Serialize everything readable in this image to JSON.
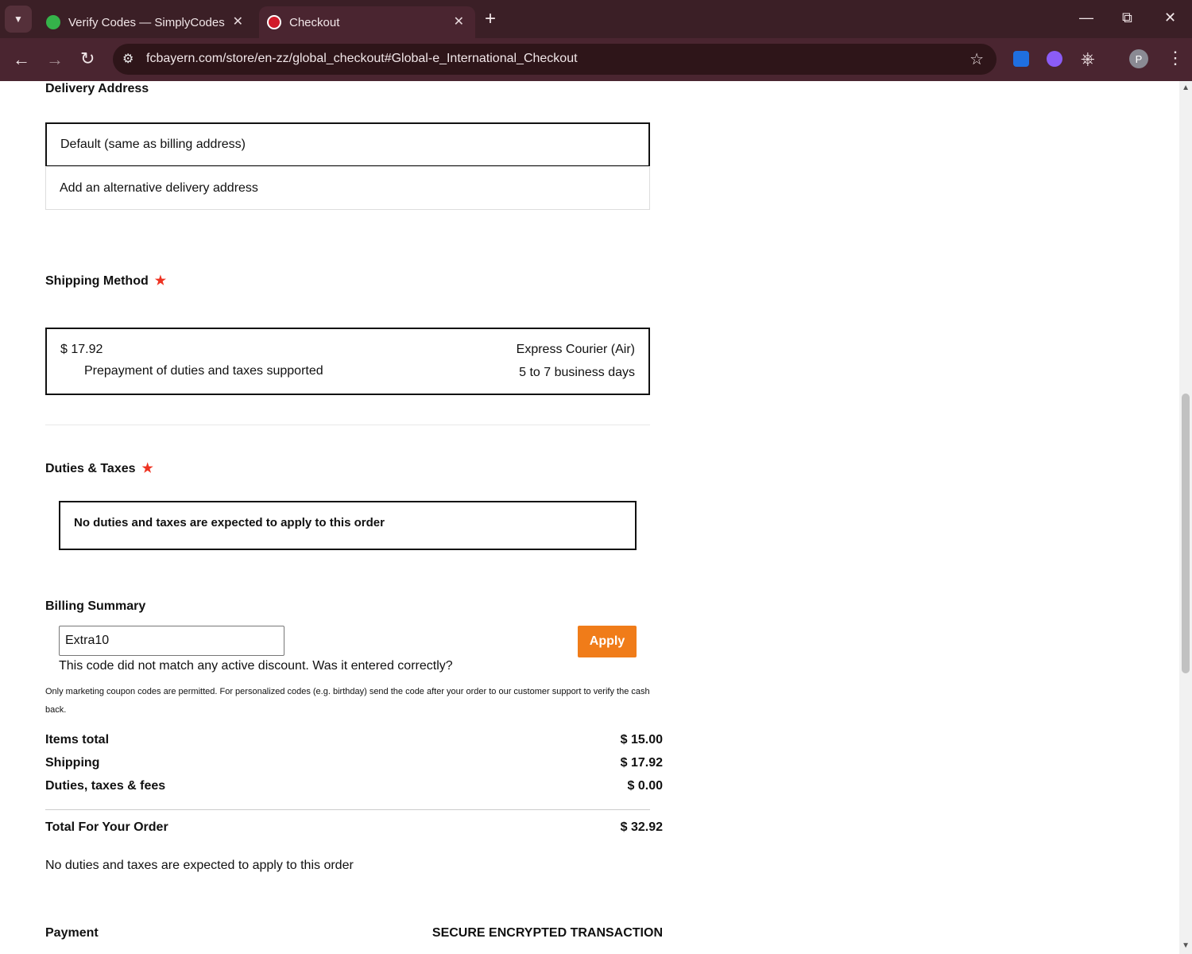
{
  "browser": {
    "tabs": [
      {
        "title": "Verify Codes — SimplyCodes",
        "active": false
      },
      {
        "title": "Checkout",
        "active": true
      }
    ],
    "url": "fcbayern.com/store/en-zz/global_checkout#Global-e_International_Checkout"
  },
  "delivery": {
    "heading": "Delivery Address",
    "options": [
      "Default (same as billing address)",
      "Add an alternative delivery address"
    ]
  },
  "shipping": {
    "heading": "Shipping Method",
    "price": "$ 17.92",
    "note": "Prepayment of duties and taxes supported",
    "carrier": "Express Courier (Air)",
    "eta": "5 to 7 business days"
  },
  "duties": {
    "heading": "Duties & Taxes",
    "message": "No duties and taxes are expected to apply to this order"
  },
  "billing": {
    "heading": "Billing Summary",
    "coupon_value": "Extra10",
    "apply_label": "Apply",
    "error": "This code did not match any active discount. Was it entered correctly?",
    "note": "Only marketing coupon codes are permitted. For personalized codes (e.g. birthday) send the code after your order to our customer support to verify the cash back.",
    "rows": [
      {
        "label": "Items total",
        "value": "$ 15.00"
      },
      {
        "label": "Shipping",
        "value": "$ 17.92"
      },
      {
        "label": "Duties, taxes & fees",
        "value": "$ 0.00"
      }
    ],
    "total_label": "Total For Your Order",
    "total_value": "$ 32.92",
    "footer_note": "No duties and taxes are expected to apply to this order"
  },
  "payment": {
    "heading": "Payment",
    "secure": "SECURE ENCRYPTED TRANSACTION"
  }
}
